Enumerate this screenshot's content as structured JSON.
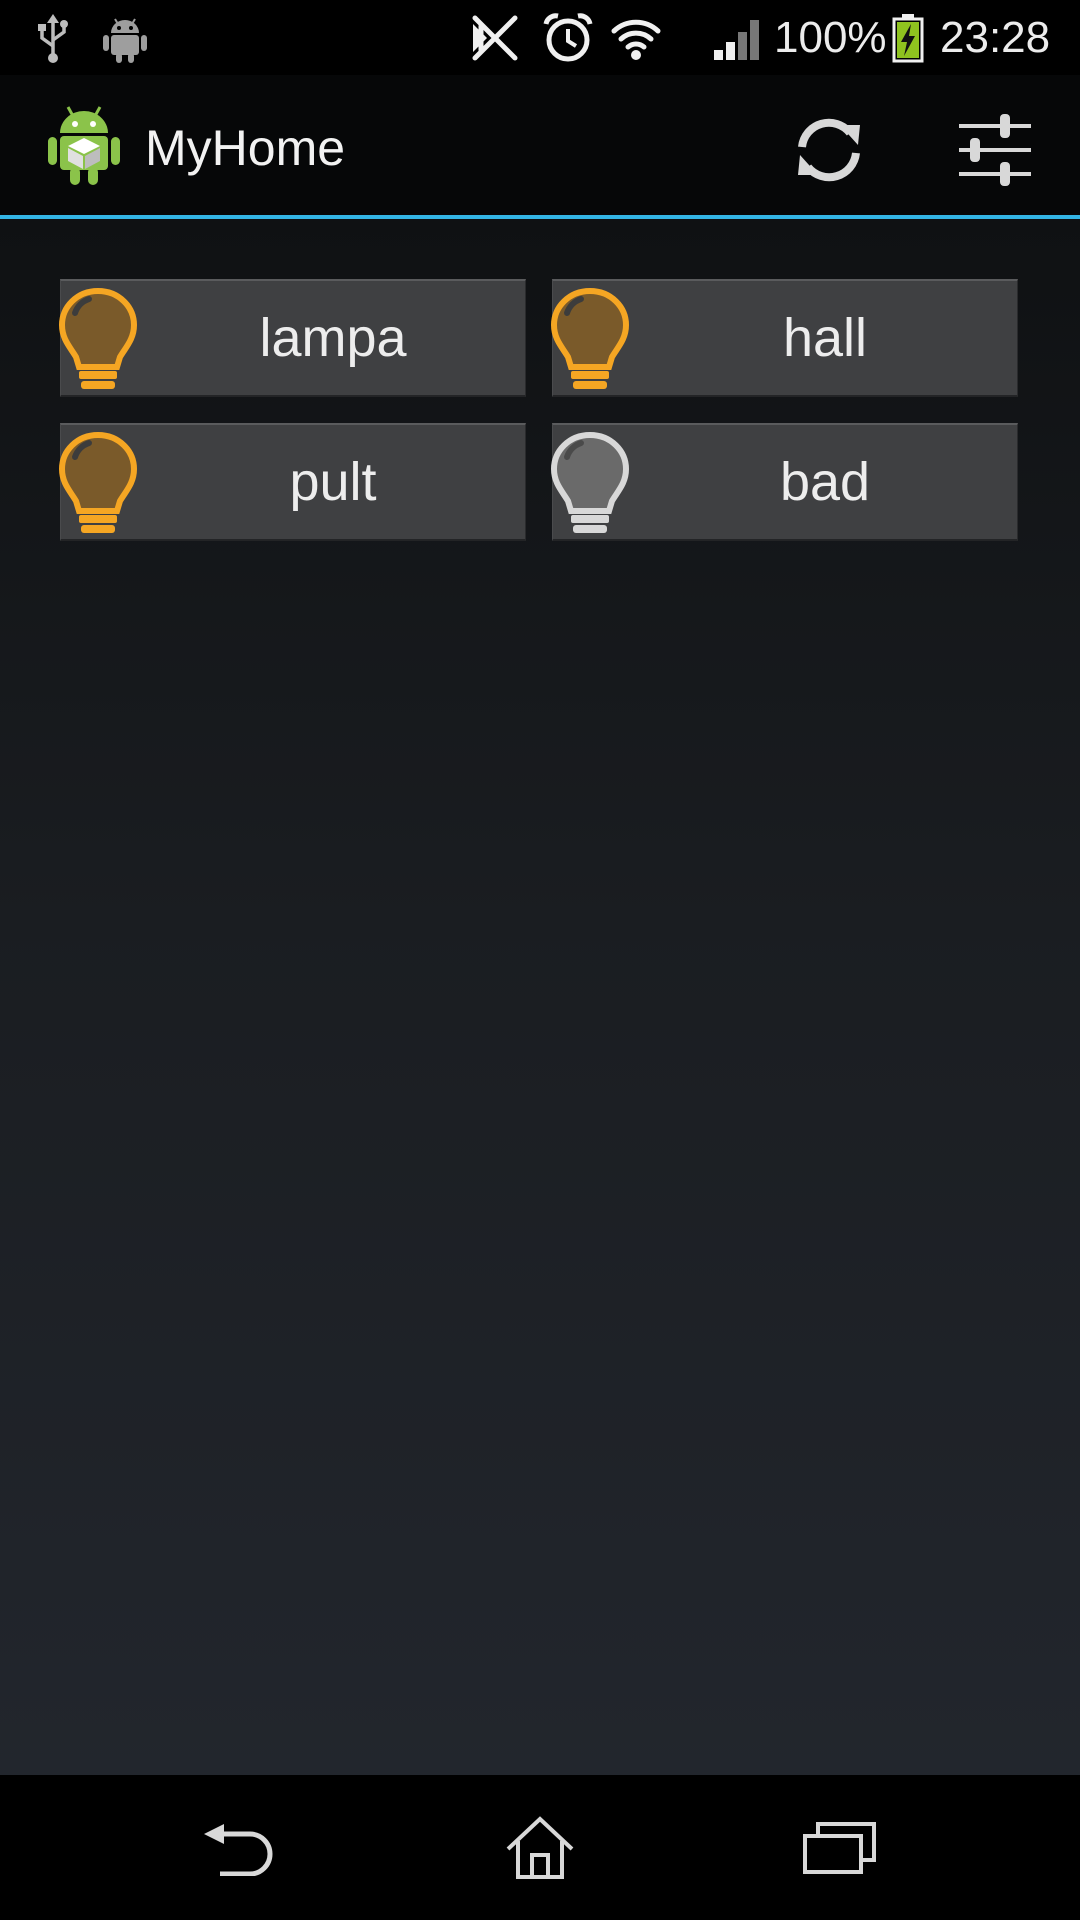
{
  "status_bar": {
    "icons_left": [
      "usb-icon",
      "android-debug-icon"
    ],
    "icons_right": [
      "nfc-off-icon",
      "alarm-icon",
      "wifi-icon",
      "signal-icon"
    ],
    "battery_percent": "100%",
    "battery_charging": true,
    "battery_level": 1.0,
    "time": "23:28"
  },
  "action_bar": {
    "app_icon": "android-app-icon",
    "title": "MyHome",
    "actions": [
      {
        "name": "refresh",
        "icon": "refresh-icon"
      },
      {
        "name": "settings",
        "icon": "sliders-icon"
      }
    ],
    "underline_color": "#33b5e5"
  },
  "lights": [
    {
      "label": "lampa",
      "on": true
    },
    {
      "label": "hall",
      "on": true
    },
    {
      "label": "pult",
      "on": true
    },
    {
      "label": "bad",
      "on": false
    }
  ],
  "colors": {
    "bulb_on": "#f5a623",
    "bulb_off": "#d8d8d8",
    "tile_bg": "#3f4042"
  },
  "nav_bar": {
    "buttons": [
      {
        "name": "back",
        "icon": "back-icon"
      },
      {
        "name": "home",
        "icon": "home-icon"
      },
      {
        "name": "recents",
        "icon": "recents-icon"
      }
    ]
  }
}
